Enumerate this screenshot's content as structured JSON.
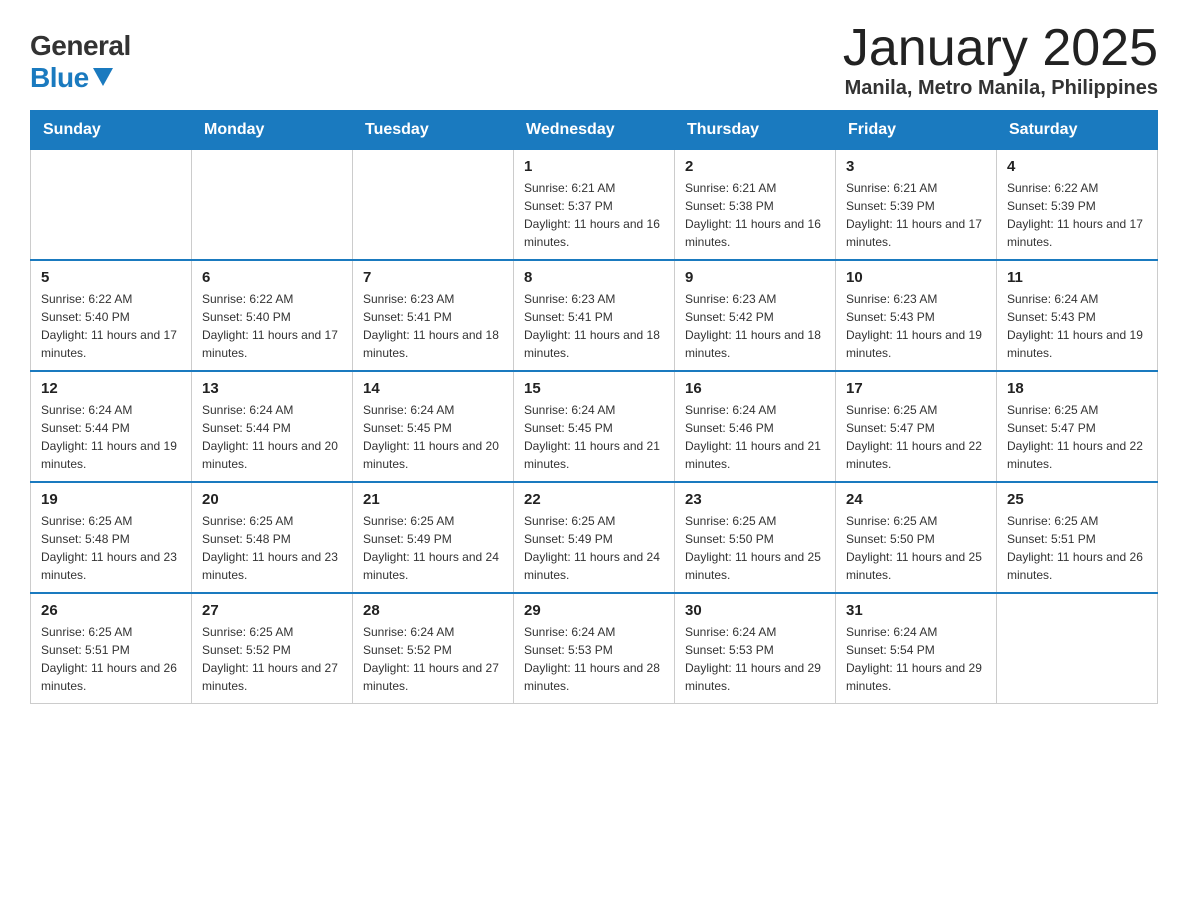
{
  "header": {
    "logo_general": "General",
    "logo_blue": "Blue",
    "month_title": "January 2025",
    "location": "Manila, Metro Manila, Philippines"
  },
  "weekdays": [
    "Sunday",
    "Monday",
    "Tuesday",
    "Wednesday",
    "Thursday",
    "Friday",
    "Saturday"
  ],
  "weeks": [
    [
      {
        "day": "",
        "sunrise": "",
        "sunset": "",
        "daylight": ""
      },
      {
        "day": "",
        "sunrise": "",
        "sunset": "",
        "daylight": ""
      },
      {
        "day": "",
        "sunrise": "",
        "sunset": "",
        "daylight": ""
      },
      {
        "day": "1",
        "sunrise": "Sunrise: 6:21 AM",
        "sunset": "Sunset: 5:37 PM",
        "daylight": "Daylight: 11 hours and 16 minutes."
      },
      {
        "day": "2",
        "sunrise": "Sunrise: 6:21 AM",
        "sunset": "Sunset: 5:38 PM",
        "daylight": "Daylight: 11 hours and 16 minutes."
      },
      {
        "day": "3",
        "sunrise": "Sunrise: 6:21 AM",
        "sunset": "Sunset: 5:39 PM",
        "daylight": "Daylight: 11 hours and 17 minutes."
      },
      {
        "day": "4",
        "sunrise": "Sunrise: 6:22 AM",
        "sunset": "Sunset: 5:39 PM",
        "daylight": "Daylight: 11 hours and 17 minutes."
      }
    ],
    [
      {
        "day": "5",
        "sunrise": "Sunrise: 6:22 AM",
        "sunset": "Sunset: 5:40 PM",
        "daylight": "Daylight: 11 hours and 17 minutes."
      },
      {
        "day": "6",
        "sunrise": "Sunrise: 6:22 AM",
        "sunset": "Sunset: 5:40 PM",
        "daylight": "Daylight: 11 hours and 17 minutes."
      },
      {
        "day": "7",
        "sunrise": "Sunrise: 6:23 AM",
        "sunset": "Sunset: 5:41 PM",
        "daylight": "Daylight: 11 hours and 18 minutes."
      },
      {
        "day": "8",
        "sunrise": "Sunrise: 6:23 AM",
        "sunset": "Sunset: 5:41 PM",
        "daylight": "Daylight: 11 hours and 18 minutes."
      },
      {
        "day": "9",
        "sunrise": "Sunrise: 6:23 AM",
        "sunset": "Sunset: 5:42 PM",
        "daylight": "Daylight: 11 hours and 18 minutes."
      },
      {
        "day": "10",
        "sunrise": "Sunrise: 6:23 AM",
        "sunset": "Sunset: 5:43 PM",
        "daylight": "Daylight: 11 hours and 19 minutes."
      },
      {
        "day": "11",
        "sunrise": "Sunrise: 6:24 AM",
        "sunset": "Sunset: 5:43 PM",
        "daylight": "Daylight: 11 hours and 19 minutes."
      }
    ],
    [
      {
        "day": "12",
        "sunrise": "Sunrise: 6:24 AM",
        "sunset": "Sunset: 5:44 PM",
        "daylight": "Daylight: 11 hours and 19 minutes."
      },
      {
        "day": "13",
        "sunrise": "Sunrise: 6:24 AM",
        "sunset": "Sunset: 5:44 PM",
        "daylight": "Daylight: 11 hours and 20 minutes."
      },
      {
        "day": "14",
        "sunrise": "Sunrise: 6:24 AM",
        "sunset": "Sunset: 5:45 PM",
        "daylight": "Daylight: 11 hours and 20 minutes."
      },
      {
        "day": "15",
        "sunrise": "Sunrise: 6:24 AM",
        "sunset": "Sunset: 5:45 PM",
        "daylight": "Daylight: 11 hours and 21 minutes."
      },
      {
        "day": "16",
        "sunrise": "Sunrise: 6:24 AM",
        "sunset": "Sunset: 5:46 PM",
        "daylight": "Daylight: 11 hours and 21 minutes."
      },
      {
        "day": "17",
        "sunrise": "Sunrise: 6:25 AM",
        "sunset": "Sunset: 5:47 PM",
        "daylight": "Daylight: 11 hours and 22 minutes."
      },
      {
        "day": "18",
        "sunrise": "Sunrise: 6:25 AM",
        "sunset": "Sunset: 5:47 PM",
        "daylight": "Daylight: 11 hours and 22 minutes."
      }
    ],
    [
      {
        "day": "19",
        "sunrise": "Sunrise: 6:25 AM",
        "sunset": "Sunset: 5:48 PM",
        "daylight": "Daylight: 11 hours and 23 minutes."
      },
      {
        "day": "20",
        "sunrise": "Sunrise: 6:25 AM",
        "sunset": "Sunset: 5:48 PM",
        "daylight": "Daylight: 11 hours and 23 minutes."
      },
      {
        "day": "21",
        "sunrise": "Sunrise: 6:25 AM",
        "sunset": "Sunset: 5:49 PM",
        "daylight": "Daylight: 11 hours and 24 minutes."
      },
      {
        "day": "22",
        "sunrise": "Sunrise: 6:25 AM",
        "sunset": "Sunset: 5:49 PM",
        "daylight": "Daylight: 11 hours and 24 minutes."
      },
      {
        "day": "23",
        "sunrise": "Sunrise: 6:25 AM",
        "sunset": "Sunset: 5:50 PM",
        "daylight": "Daylight: 11 hours and 25 minutes."
      },
      {
        "day": "24",
        "sunrise": "Sunrise: 6:25 AM",
        "sunset": "Sunset: 5:50 PM",
        "daylight": "Daylight: 11 hours and 25 minutes."
      },
      {
        "day": "25",
        "sunrise": "Sunrise: 6:25 AM",
        "sunset": "Sunset: 5:51 PM",
        "daylight": "Daylight: 11 hours and 26 minutes."
      }
    ],
    [
      {
        "day": "26",
        "sunrise": "Sunrise: 6:25 AM",
        "sunset": "Sunset: 5:51 PM",
        "daylight": "Daylight: 11 hours and 26 minutes."
      },
      {
        "day": "27",
        "sunrise": "Sunrise: 6:25 AM",
        "sunset": "Sunset: 5:52 PM",
        "daylight": "Daylight: 11 hours and 27 minutes."
      },
      {
        "day": "28",
        "sunrise": "Sunrise: 6:24 AM",
        "sunset": "Sunset: 5:52 PM",
        "daylight": "Daylight: 11 hours and 27 minutes."
      },
      {
        "day": "29",
        "sunrise": "Sunrise: 6:24 AM",
        "sunset": "Sunset: 5:53 PM",
        "daylight": "Daylight: 11 hours and 28 minutes."
      },
      {
        "day": "30",
        "sunrise": "Sunrise: 6:24 AM",
        "sunset": "Sunset: 5:53 PM",
        "daylight": "Daylight: 11 hours and 29 minutes."
      },
      {
        "day": "31",
        "sunrise": "Sunrise: 6:24 AM",
        "sunset": "Sunset: 5:54 PM",
        "daylight": "Daylight: 11 hours and 29 minutes."
      },
      {
        "day": "",
        "sunrise": "",
        "sunset": "",
        "daylight": ""
      }
    ]
  ]
}
